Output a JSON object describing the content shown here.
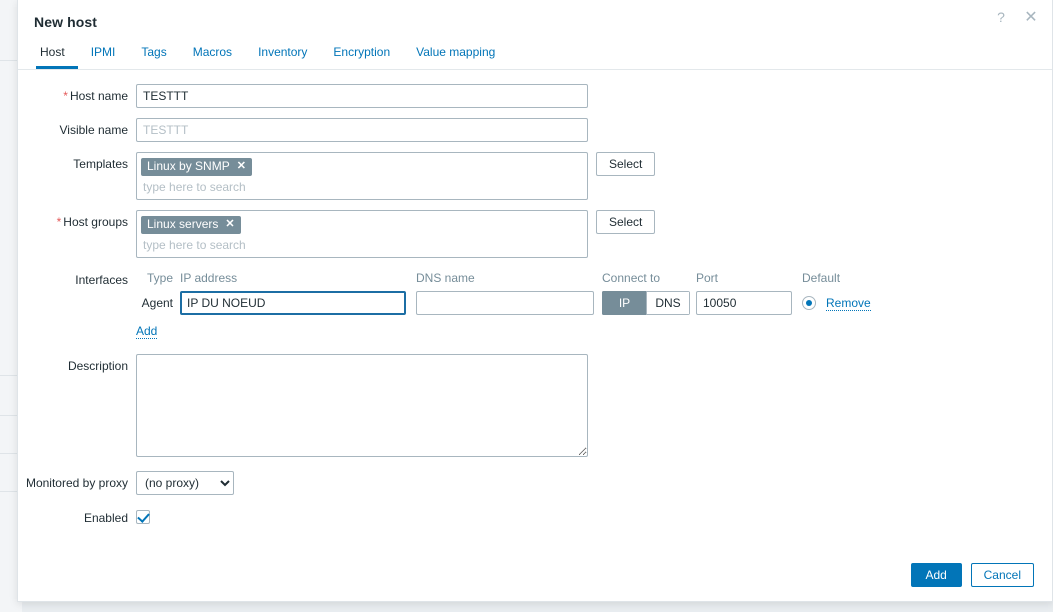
{
  "modal": {
    "title": "New host",
    "help_icon": "question-mark-icon",
    "close_icon": "close-icon"
  },
  "tabs": [
    {
      "label": "Host",
      "active": true
    },
    {
      "label": "IPMI",
      "active": false
    },
    {
      "label": "Tags",
      "active": false
    },
    {
      "label": "Macros",
      "active": false
    },
    {
      "label": "Inventory",
      "active": false
    },
    {
      "label": "Encryption",
      "active": false
    },
    {
      "label": "Value mapping",
      "active": false
    }
  ],
  "form": {
    "host_name": {
      "label": "Host name",
      "required": true,
      "value": "TESTTT"
    },
    "visible_name": {
      "label": "Visible name",
      "required": false,
      "value": "",
      "placeholder": "TESTTT"
    },
    "templates": {
      "label": "Templates",
      "required": false,
      "chips": [
        "Linux by SNMP"
      ],
      "search_placeholder": "type here to search",
      "select_label": "Select"
    },
    "host_groups": {
      "label": "Host groups",
      "required": true,
      "chips": [
        "Linux servers"
      ],
      "search_placeholder": "type here to search",
      "select_label": "Select"
    },
    "interfaces": {
      "label": "Interfaces",
      "columns": {
        "type": "Type",
        "ip_address": "IP address",
        "dns_name": "DNS name",
        "connect_to": "Connect to",
        "port": "Port",
        "default": "Default"
      },
      "rows": [
        {
          "type": "Agent",
          "ip_address": "IP DU NOEUD",
          "ip_focused": true,
          "dns_name": "",
          "connect_to_options": [
            "IP",
            "DNS"
          ],
          "connect_to_selected": "IP",
          "port": "10050",
          "default_selected": true,
          "remove_label": "Remove"
        }
      ],
      "add_label": "Add"
    },
    "description": {
      "label": "Description",
      "value": ""
    },
    "monitored_by_proxy": {
      "label": "Monitored by proxy",
      "selected": "(no proxy)",
      "options": [
        "(no proxy)"
      ]
    },
    "enabled": {
      "label": "Enabled",
      "checked": true
    }
  },
  "footer": {
    "add_label": "Add",
    "cancel_label": "Cancel"
  },
  "colors": {
    "accent": "#0275b8",
    "chip_bg": "#768d99",
    "required_marker": "#e45959",
    "text": "#1f2c33",
    "muted": "#768d99"
  }
}
